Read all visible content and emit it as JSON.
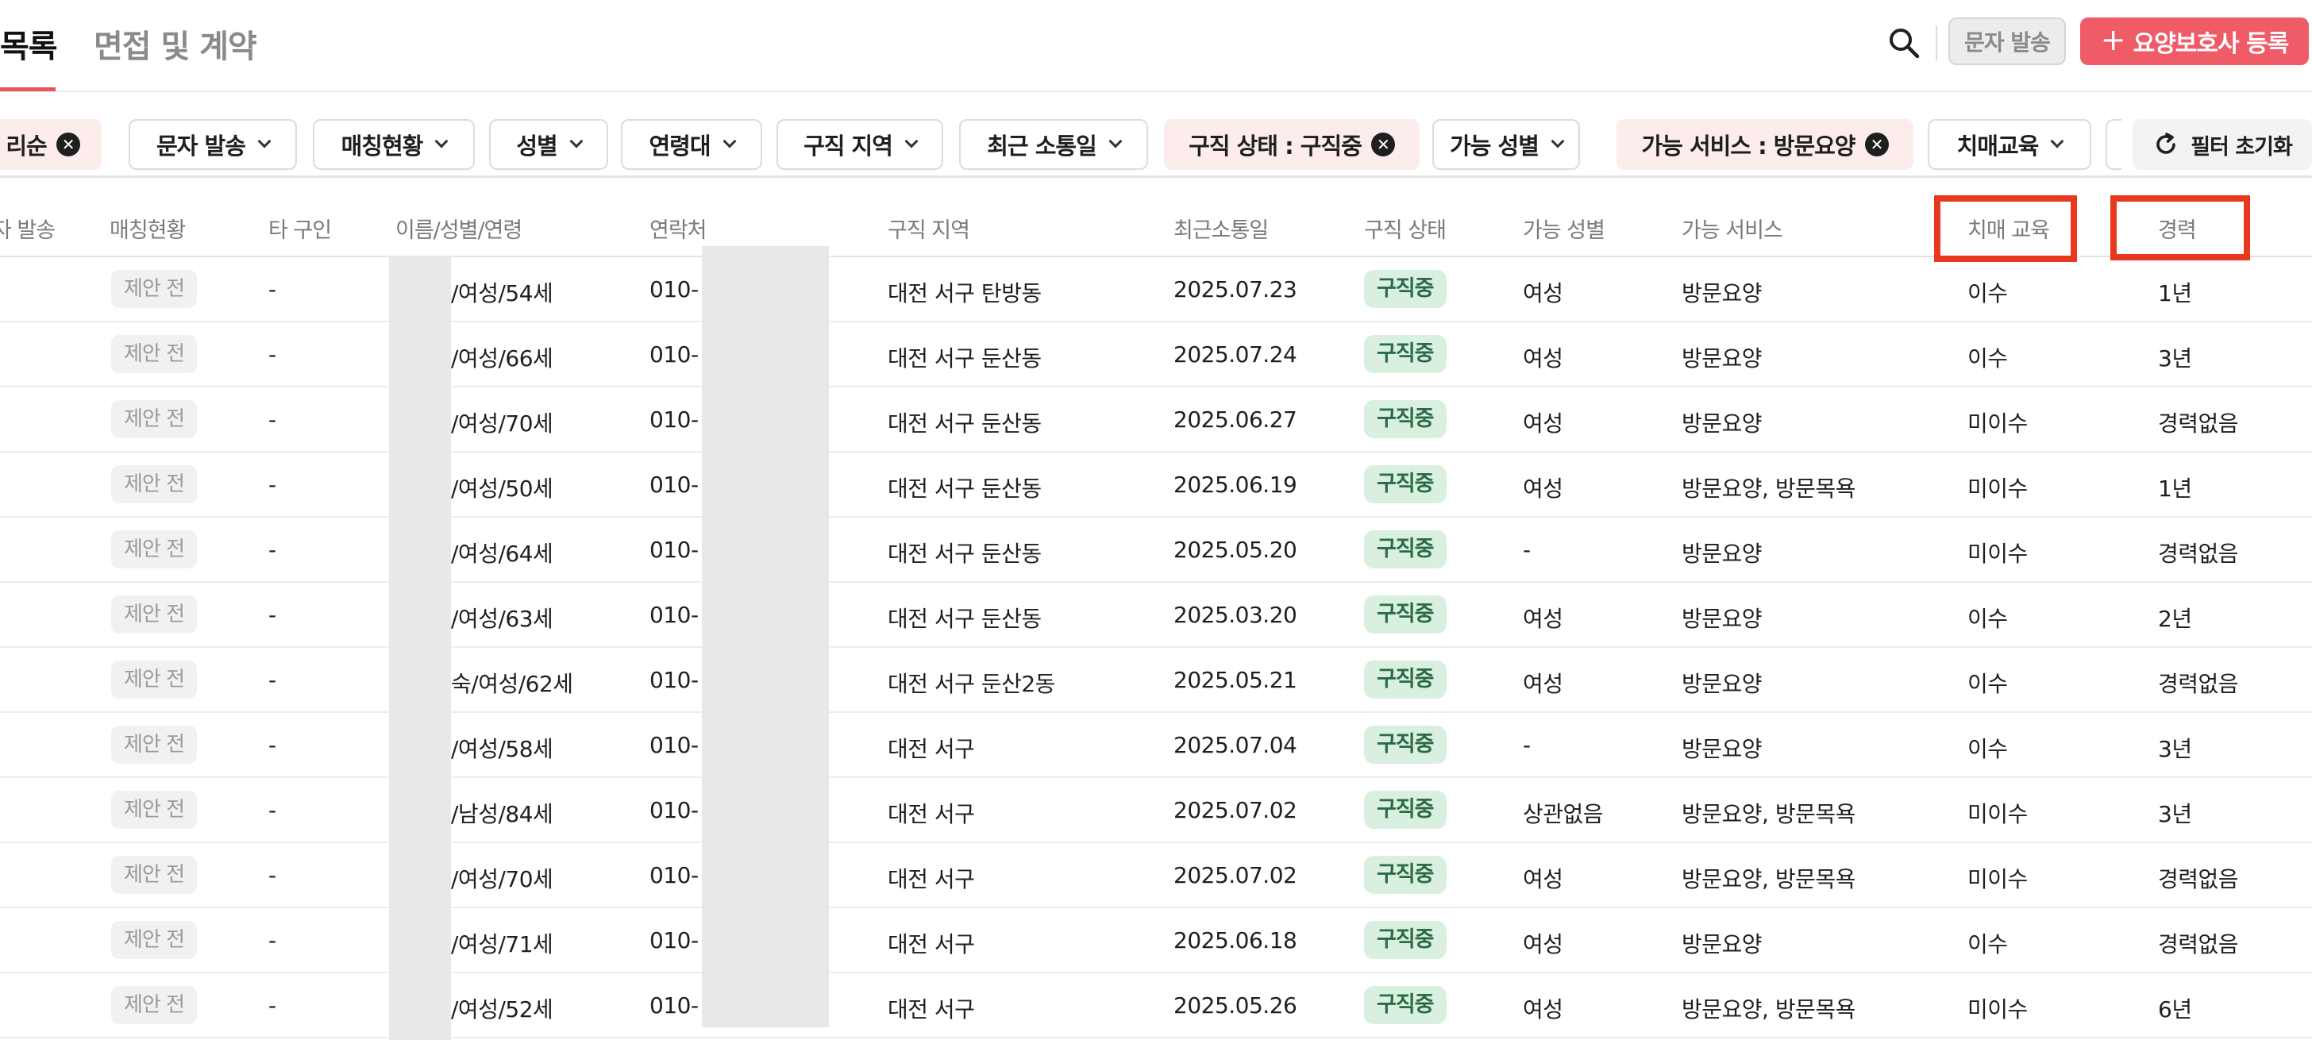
{
  "header": {
    "tab_active": "목록",
    "tab_inactive": "면접 및 계약",
    "sms_button": "문자 발송",
    "register_button": "요양보호사 등록",
    "plus": "+"
  },
  "filters": {
    "chips": [
      {
        "label": "리순",
        "active": true,
        "close": true
      },
      {
        "label": "문자 발송",
        "active": false
      },
      {
        "label": "매칭현황",
        "active": false
      },
      {
        "label": "성별",
        "active": false
      },
      {
        "label": "연령대",
        "active": false
      },
      {
        "label": "구직 지역",
        "active": false
      },
      {
        "label": "최근 소통일",
        "active": false
      },
      {
        "label": "구직 상태 : 구직중",
        "active": true,
        "close": true
      },
      {
        "label": "가능 성별",
        "active": false
      },
      {
        "label": "가능 서비스 : 방문요양",
        "active": true,
        "close": true
      },
      {
        "label": "치매교육",
        "active": false
      }
    ],
    "reset_label": "필터 초기화",
    "close_glyph": "✕"
  },
  "table": {
    "headers": [
      "자 발송",
      "매칭현황",
      "타 구인",
      "이름/성별/연령",
      "연락처",
      "구직 지역",
      "최근소통일",
      "구직 상태",
      "가능 성별",
      "가능 서비스",
      "치매 교육",
      "경력"
    ],
    "rows": [
      {
        "match": "제안 전",
        "other": "-",
        "name": "/여성/54세",
        "phone": "010-",
        "region": "대전 서구 탄방동",
        "date": "2025.07.23",
        "status": "구직중",
        "gender": "여성",
        "service": "방문요양",
        "dementia": "이수",
        "career": "1년"
      },
      {
        "match": "제안 전",
        "other": "-",
        "name": "/여성/66세",
        "phone": "010-",
        "region": "대전 서구 둔산동",
        "date": "2025.07.24",
        "status": "구직중",
        "gender": "여성",
        "service": "방문요양",
        "dementia": "이수",
        "career": "3년"
      },
      {
        "match": "제안 전",
        "other": "-",
        "name": "/여성/70세",
        "phone": "010-",
        "region": "대전 서구 둔산동",
        "date": "2025.06.27",
        "status": "구직중",
        "gender": "여성",
        "service": "방문요양",
        "dementia": "미이수",
        "career": "경력없음"
      },
      {
        "match": "제안 전",
        "other": "-",
        "name": "/여성/50세",
        "phone": "010-",
        "region": "대전 서구 둔산동",
        "date": "2025.06.19",
        "status": "구직중",
        "gender": "여성",
        "service": "방문요양, 방문목욕",
        "dementia": "미이수",
        "career": "1년"
      },
      {
        "match": "제안 전",
        "other": "-",
        "name": "/여성/64세",
        "phone": "010-",
        "region": "대전 서구 둔산동",
        "date": "2025.05.20",
        "status": "구직중",
        "gender": "-",
        "service": "방문요양",
        "dementia": "미이수",
        "career": "경력없음"
      },
      {
        "match": "제안 전",
        "other": "-",
        "name": "/여성/63세",
        "phone": "010-",
        "region": "대전 서구 둔산동",
        "date": "2025.03.20",
        "status": "구직중",
        "gender": "여성",
        "service": "방문요양",
        "dementia": "이수",
        "career": "2년"
      },
      {
        "match": "제안 전",
        "other": "-",
        "name": "숙/여성/62세",
        "phone": "010-",
        "region": "대전 서구 둔산2동",
        "date": "2025.05.21",
        "status": "구직중",
        "gender": "여성",
        "service": "방문요양",
        "dementia": "이수",
        "career": "경력없음"
      },
      {
        "match": "제안 전",
        "other": "-",
        "name": "/여성/58세",
        "phone": "010-",
        "region": "대전 서구",
        "date": "2025.07.04",
        "status": "구직중",
        "gender": "-",
        "service": "방문요양",
        "dementia": "이수",
        "career": "3년"
      },
      {
        "match": "제안 전",
        "other": "-",
        "name": "/남성/84세",
        "phone": "010-",
        "region": "대전 서구",
        "date": "2025.07.02",
        "status": "구직중",
        "gender": "상관없음",
        "service": "방문요양, 방문목욕",
        "dementia": "미이수",
        "career": "3년"
      },
      {
        "match": "제안 전",
        "other": "-",
        "name": "/여성/70세",
        "phone": "010-",
        "region": "대전 서구",
        "date": "2025.07.02",
        "status": "구직중",
        "gender": "여성",
        "service": "방문요양, 방문목욕",
        "dementia": "미이수",
        "career": "경력없음"
      },
      {
        "match": "제안 전",
        "other": "-",
        "name": "/여성/71세",
        "phone": "010-",
        "region": "대전 서구",
        "date": "2025.06.18",
        "status": "구직중",
        "gender": "여성",
        "service": "방문요양",
        "dementia": "이수",
        "career": "경력없음"
      },
      {
        "match": "제안 전",
        "other": "-",
        "name": "/여성/52세",
        "phone": "010-",
        "region": "대전 서구",
        "date": "2025.05.26",
        "status": "구직중",
        "gender": "여성",
        "service": "방문요양, 방문목욕",
        "dementia": "미이수",
        "career": "6년"
      }
    ]
  },
  "colors": {
    "accent": "#ef5b66",
    "active_chip_bg": "#fdecec",
    "status_green_bg": "#d9f0e1",
    "highlight": "#e8391f"
  }
}
